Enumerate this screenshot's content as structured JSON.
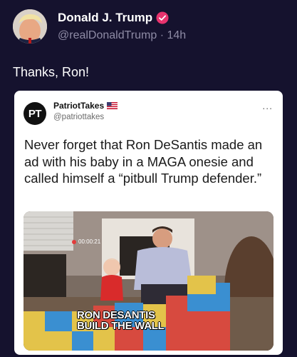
{
  "post": {
    "author_name": "Donald J. Trump",
    "author_handle": "@realDonaldTrump",
    "separator": "·",
    "time": "14h",
    "text": "Thanks, Ron!"
  },
  "quoted": {
    "author_name": "PatriotTakes",
    "author_handle": "@patriottakes",
    "logo_text": "PT",
    "more_label": "...",
    "text": "Never forget that Ron DeSantis made an ad with his baby in a MAGA onesie and called himself a “pitbull Trump defender.”",
    "video": {
      "timestamp": "00:00:21",
      "caption_line1": "RON DESANTIS",
      "caption_line2": "BUILD THE WALL"
    }
  },
  "colors": {
    "background": "#15122e",
    "verified_badge": "#e8336e",
    "handle_text": "#8e8ba5",
    "card_background": "#ffffff"
  },
  "icons": [
    "verified-badge-icon",
    "us-flag-icon",
    "more-options-icon"
  ]
}
